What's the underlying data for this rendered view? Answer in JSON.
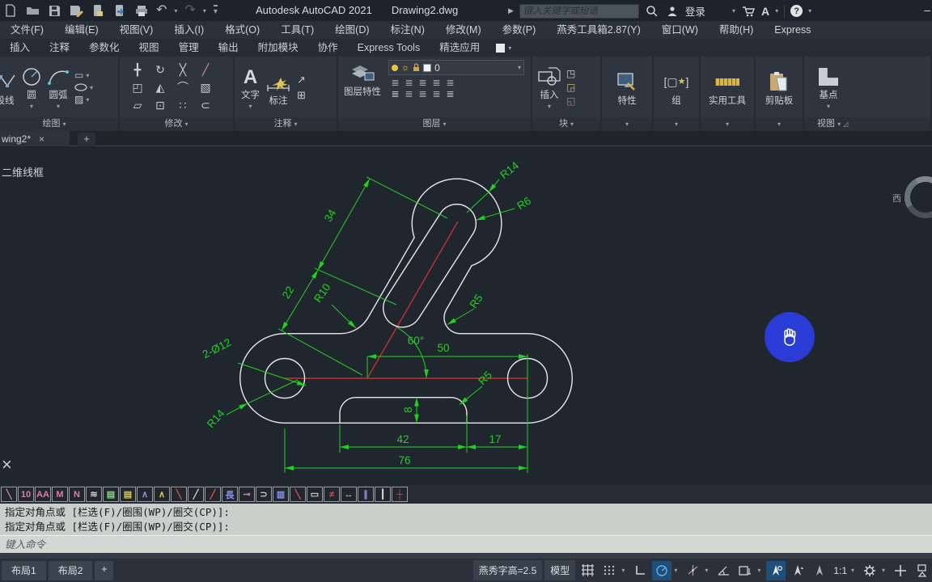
{
  "titlebar": {
    "app_title": "Autodesk AutoCAD 2021",
    "doc_name": "Drawing2.dwg",
    "search_placeholder": "键入关键字或短语",
    "signin_label": "登录",
    "a_store": "A",
    "help_mark": "?",
    "minimize": "–"
  },
  "menubar": {
    "items": [
      "文件(F)",
      "编辑(E)",
      "视图(V)",
      "插入(I)",
      "格式(O)",
      "工具(T)",
      "绘图(D)",
      "标注(N)",
      "修改(M)",
      "参数(P)",
      "燕秀工具箱2.87(Y)",
      "窗口(W)",
      "帮助(H)",
      "Express"
    ]
  },
  "ribbon": {
    "tabs": [
      "插入",
      "注释",
      "参数化",
      "视图",
      "管理",
      "输出",
      "附加模块",
      "协作",
      "Express Tools",
      "精选应用"
    ],
    "draw": {
      "label": "绘图",
      "polyline": "段线",
      "circle": "圆",
      "arc": "圆弧"
    },
    "modify": {
      "label": "修改",
      "glyphs": [
        {
          "g": "╋"
        },
        {
          "g": "↻"
        },
        {
          "g": "╳"
        },
        {
          "g": "╱",
          "c": "#e08a9a"
        },
        {
          "g": "◰"
        },
        {
          "g": "◭"
        },
        {
          "g": "⌒"
        },
        {
          "g": "▧"
        },
        {
          "g": "▱"
        },
        {
          "g": "⊡"
        },
        {
          "g": "∷"
        },
        {
          "g": "⊂"
        }
      ]
    },
    "annotate": {
      "label": "注释",
      "text_btn": "文字",
      "dim_btn": "标注"
    },
    "layers": {
      "label": "图层",
      "props_btn": "图层特性",
      "current_layer": "0",
      "minis": [
        {
          "g": "≣",
          "c": "#5bc8c8"
        },
        {
          "g": "≣",
          "c": "#9aa3ac"
        },
        {
          "g": "≣",
          "c": "#5bc8c8"
        },
        {
          "g": "≣",
          "c": "#5bc8c8"
        },
        {
          "g": "≣",
          "c": "#9aa3ac"
        },
        {
          "g": "≣",
          "c": "#d8c85a"
        },
        {
          "g": "≣",
          "c": "#9aa3ac"
        },
        {
          "g": "≣",
          "c": "#d8a04a"
        },
        {
          "g": "≣",
          "c": "#d8a04a"
        },
        {
          "g": "≣",
          "c": "#c8b890"
        }
      ]
    },
    "block": {
      "label": "块",
      "insert_btn": "插入"
    },
    "props": {
      "label": "特性"
    },
    "group": {
      "label": "组"
    },
    "utils": {
      "label": "实用工具"
    },
    "clipboard": {
      "label": "剪贴板"
    },
    "base": {
      "label": "基点",
      "view_footer": "视图"
    }
  },
  "doctab": {
    "name": "wing2*",
    "close": "×",
    "add": "+"
  },
  "viewport": {
    "view_style": "二维线框",
    "compass_west": "西"
  },
  "drawing": {
    "d76": "76",
    "d42": "42",
    "d17": "17",
    "d8": "8",
    "d50": "50",
    "a60": "60°",
    "d34": "34",
    "d22": "22",
    "r10": "R10",
    "r14_top": "R14",
    "r14_bottom": "R14",
    "r6": "R6",
    "r5_arm": "R5",
    "r5_notch": "R5",
    "holes": "2-Ø12"
  },
  "yx": {
    "icons": [
      {
        "g": "╲",
        "c": "#d87fb0"
      },
      {
        "g": "10",
        "c": "#d87fb0"
      },
      {
        "g": "AA",
        "c": "#d87fb0"
      },
      {
        "g": "M",
        "c": "#d87fb0"
      },
      {
        "g": "N",
        "c": "#d87fb0"
      },
      {
        "g": "≋",
        "c": "#c9ced4"
      },
      {
        "g": "▤",
        "c": "#8fd18f"
      },
      {
        "g": "▤",
        "c": "#d8c85a"
      },
      {
        "g": "∧",
        "c": "#8a93e8"
      },
      {
        "g": "∧",
        "c": "#d8c85a"
      },
      {
        "g": "╲",
        "c": "#d05050"
      },
      {
        "g": "╱",
        "c": "#c9ced4"
      },
      {
        "g": "╱",
        "c": "#d05050"
      },
      {
        "g": "長",
        "c": "#8a93e8"
      },
      {
        "g": "⊸",
        "c": "#d87fb0"
      },
      {
        "g": "⊃",
        "c": "#c9ced4"
      },
      {
        "g": "▥",
        "c": "#8a93e8"
      },
      {
        "g": "╲",
        "c": "#d05050"
      },
      {
        "g": "▭",
        "c": "#c9ced4"
      },
      {
        "g": "≠",
        "c": "#d05050"
      },
      {
        "g": "↔",
        "c": "#c9ced4"
      },
      {
        "g": "∥",
        "c": "#8a93e8"
      },
      {
        "g": "┃",
        "c": "#c9ced4"
      },
      {
        "g": "┼",
        "c": "#d05050"
      }
    ]
  },
  "cmd": {
    "history": [
      "指定对角点或 [栏选(F)/圈围(WP)/圈交(CP)]:",
      "指定对角点或 [栏选(F)/圈围(WP)/圈交(CP)]:"
    ],
    "prompt": "键入命令"
  },
  "status": {
    "layouts": [
      "布局1",
      "布局2"
    ],
    "add_layout": "+",
    "yx_textheight": "燕秀字高=2.5",
    "model": "模型",
    "scale": "1:1"
  },
  "colors": {
    "dim_green": "#22d022",
    "geometry_white": "#e8e8e8",
    "centerline_red": "#c23232",
    "pan_blue": "#2b3cd6"
  }
}
